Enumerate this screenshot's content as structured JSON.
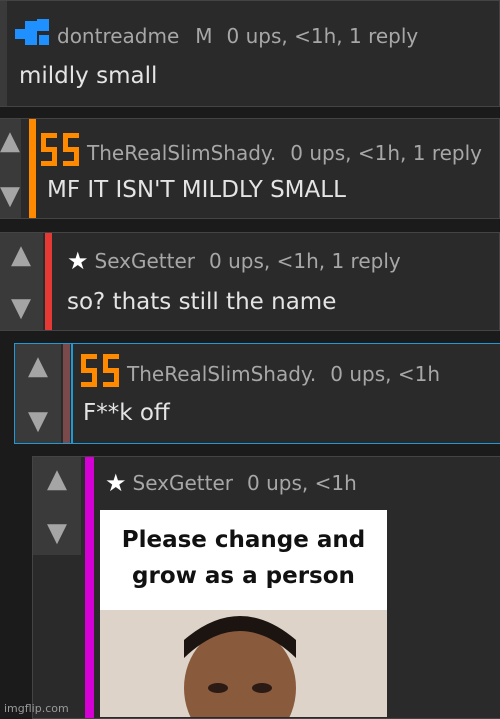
{
  "comments": [
    {
      "user": "dontreadme",
      "badge": "M",
      "meta": "0 ups, <1h, 1 reply",
      "text": "mildly small",
      "bar_color": "#2a2a2a",
      "icon": "puzzle-logo-icon"
    },
    {
      "user": "TheRealSlimShady.",
      "meta": "0 ups, <1h, 1 reply",
      "text": "MF IT ISN'T MILDLY SMALL",
      "bar_color": "#ff8a00",
      "icon": "orange-logo-icon"
    },
    {
      "user": "SexGetter",
      "meta": "0 ups, <1h, 1 reply",
      "text": "so? thats still the name",
      "bar_color": "#e53935",
      "icon": "star-icon"
    },
    {
      "user": "TheRealSlimShady.",
      "meta": "0 ups, <1h",
      "text": "F**k off",
      "bar_color": "#7a4a4a",
      "icon": "orange-logo-icon"
    },
    {
      "user": "SexGetter",
      "meta": "0 ups, <1h",
      "text": "",
      "bar_color": "#d400d4",
      "icon": "star-icon"
    }
  ],
  "meme": {
    "caption": "Please change and grow as a person"
  },
  "watermark": "imgflip.com",
  "vote_icons": {
    "up": "▲",
    "down": "▼"
  }
}
